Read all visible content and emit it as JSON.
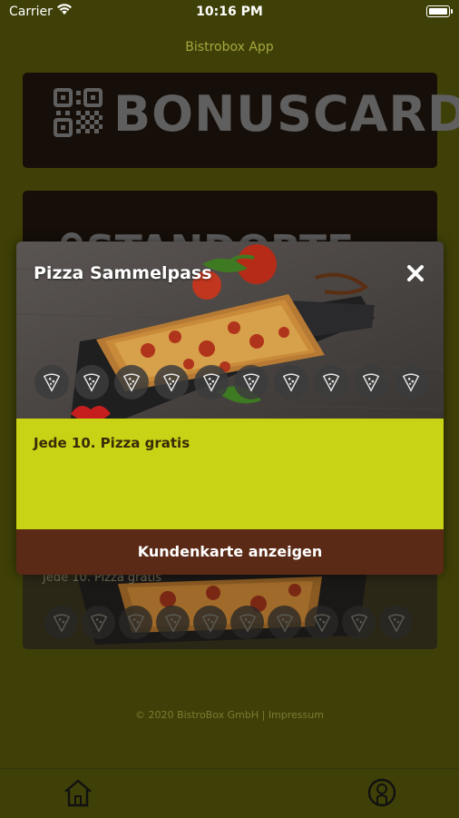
{
  "status_bar": {
    "carrier": "Carrier",
    "time": "10:16 PM"
  },
  "app": {
    "title": "Bistrobox App"
  },
  "bonus_card": {
    "label": "BONUSCARD"
  },
  "location_card": {
    "label": "STANDORTE"
  },
  "background_card": {
    "subtitle": "Jede 10. Pizza gratis"
  },
  "modal": {
    "title": "Pizza Sammelpass",
    "rule_text": "Jede 10. Pizza gratis",
    "cta_label": "Kundenkarte anzeigen",
    "stamps_total": 10,
    "stamps_collected": 0,
    "close_icon": "close-icon"
  },
  "footer": {
    "text": "© 2020 BistroBox GmbH | Impressum"
  },
  "tabbar": {
    "items": [
      {
        "icon": "home-icon"
      },
      {
        "icon": "profile-icon"
      }
    ]
  },
  "colors": {
    "background": "#3f4007",
    "accent_lime": "#c7d314",
    "cta_brown": "#5b2a16",
    "card_dark": "#160e08"
  }
}
